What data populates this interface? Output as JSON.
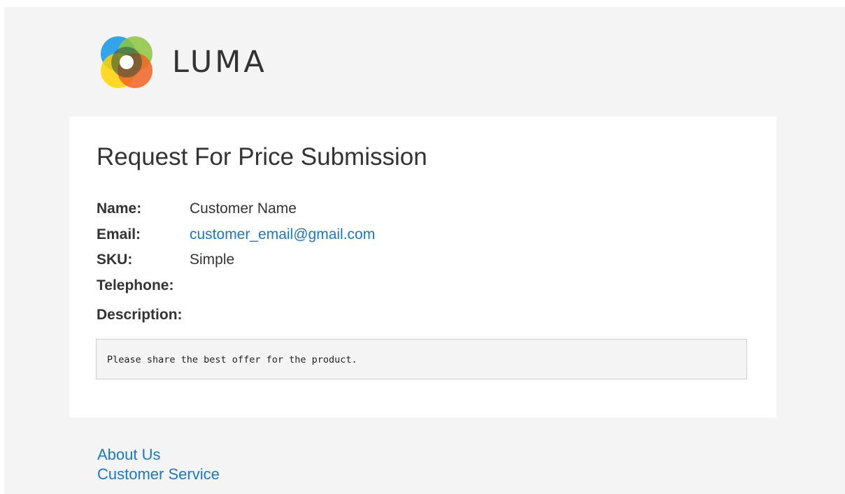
{
  "brand": {
    "logo_text": "LUMA",
    "logo_colors": [
      "#1d9be9",
      "#8cc63f",
      "#ffd400",
      "#f26322"
    ]
  },
  "email": {
    "title": "Request For Price Submission",
    "fields": [
      {
        "label": "Name:",
        "value": "Customer Name"
      },
      {
        "label": "Email:",
        "value": "customer_email@gmail.com"
      },
      {
        "label": "SKU:",
        "value": "Simple"
      },
      {
        "label": "Telephone:",
        "value": ""
      }
    ],
    "description_label": "Description:",
    "description_text": "Please share the best offer for the product."
  },
  "footer": {
    "links": [
      "About Us",
      "Customer Service"
    ]
  },
  "colors": {
    "link": "#1979c3",
    "text": "#333333",
    "background": "#f4f4f4"
  }
}
